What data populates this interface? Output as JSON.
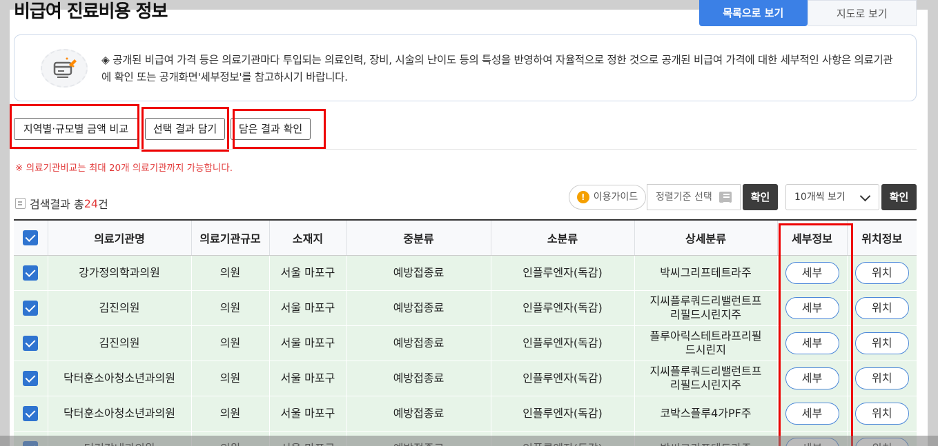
{
  "page": {
    "title": "비급여 진료비용 정보",
    "tabs": [
      "목록으로 보기",
      "지도로 보기"
    ]
  },
  "notice": {
    "text": "◈ 공개된 비급여 가격 등은 의료기관마다 투입되는 의료인력, 장비, 시술의 난이도 등의 특성을 반영하여 자율적으로 정한 것으로 공개된 비급여 가격에 대한 세부적인 사항은 의료기관에 확인 또는 공개화면'세부정보'를 참고하시기 바랍니다.",
    "icon": "card-pencil-icon"
  },
  "actions": {
    "compare": "지역별·규모별 금액 비교",
    "add": "선택 결과 담기",
    "view": "담은 결과 확인"
  },
  "warning": "※ 의료기관비교는 최대 20개 의료기관까지 가능합니다.",
  "results": {
    "prefix": "검색결과 총",
    "count": "24",
    "suffix": "건"
  },
  "toolbar": {
    "guide": "이용가이드",
    "sort_placeholder": "정렬기준 선택",
    "confirm": "확인",
    "per_page": "10개씩 보기",
    "confirm2": "확인"
  },
  "table": {
    "headers": [
      "의료기관명",
      "의료기관규모",
      "소재지",
      "중분류",
      "소분류",
      "상세분류",
      "세부정보",
      "위치정보"
    ],
    "rows": [
      {
        "name": "강가정의학과의원",
        "size": "의원",
        "loc": "서울 마포구",
        "mid": "예방접종료",
        "sub": "인플루엔자(독감)",
        "detail": "박씨그리프테트라주",
        "btn1": "세부",
        "btn2": "위치"
      },
      {
        "name": "김진의원",
        "size": "의원",
        "loc": "서울 마포구",
        "mid": "예방접종료",
        "sub": "인플루엔자(독감)",
        "detail": "지씨플루쿼드리밸런트프리필드시린지주",
        "btn1": "세부",
        "btn2": "위치"
      },
      {
        "name": "김진의원",
        "size": "의원",
        "loc": "서울 마포구",
        "mid": "예방접종료",
        "sub": "인플루엔자(독감)",
        "detail": "플루아릭스테트라프리필드시린지",
        "btn1": "세부",
        "btn2": "위치"
      },
      {
        "name": "닥터훈소아청소년과의원",
        "size": "의원",
        "loc": "서울 마포구",
        "mid": "예방접종료",
        "sub": "인플루엔자(독감)",
        "detail": "지씨플루쿼드리밸런트프리필드시린지주",
        "btn1": "세부",
        "btn2": "위치"
      },
      {
        "name": "닥터훈소아청소년과의원",
        "size": "의원",
        "loc": "서울 마포구",
        "mid": "예방접종료",
        "sub": "인플루엔자(독감)",
        "detail": "코박스플루4가PF주",
        "btn1": "세부",
        "btn2": "위치"
      },
      {
        "name": "더건강내과의원",
        "size": "의원",
        "loc": "서울 마포구",
        "mid": "예방접종료",
        "sub": "인플루엔자(독감)",
        "detail": "박씨그리프테트라주",
        "btn1": "세부",
        "btn2": "위치"
      }
    ]
  },
  "colors": {
    "accent": "#3b80e6",
    "highlight_red": "#e00000",
    "row_bg": "#e7f4e8"
  }
}
